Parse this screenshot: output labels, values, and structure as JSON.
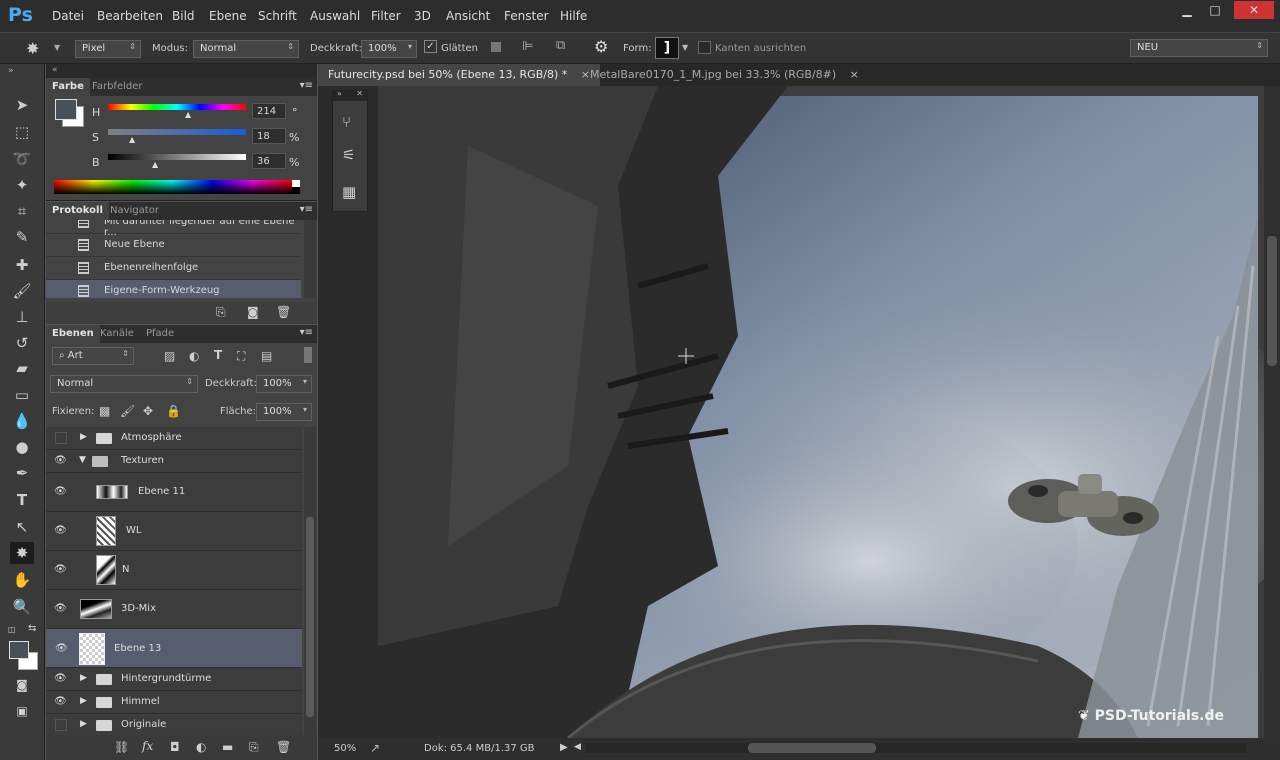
{
  "menubar": {
    "logo": "Ps",
    "items": [
      "Datei",
      "Bearbeiten",
      "Bild",
      "Ebene",
      "Schrift",
      "Auswahl",
      "Filter",
      "3D",
      "Ansicht",
      "Fenster",
      "Hilfe"
    ],
    "minimize": "▁",
    "maximize": "□",
    "close": "✕"
  },
  "options": {
    "mode_select": "Pixel",
    "modus_label": "Modus:",
    "modus_value": "Normal",
    "opacity_label": "Deckkraft:",
    "opacity_value": "100%",
    "smooth_label": "Glätten",
    "form_label": "Form:",
    "align_label": "Kanten ausrichten",
    "workspace": "NEU"
  },
  "color_panel": {
    "tabs": [
      "Farbe",
      "Farbfelder"
    ],
    "h_label": "H",
    "h_value": "214",
    "h_unit": "°",
    "s_label": "S",
    "s_value": "18",
    "s_unit": "%",
    "b_label": "B",
    "b_value": "36",
    "b_unit": "%"
  },
  "history_panel": {
    "tabs": [
      "Protokoll",
      "Navigator"
    ],
    "items": [
      "Mit darunter liegender auf eine Ebene r...",
      "Neue Ebene",
      "Ebenenreihenfolge",
      "Eigene-Form-Werkzeug"
    ]
  },
  "layers_panel": {
    "tabs": [
      "Ebenen",
      "Kanäle",
      "Pfade"
    ],
    "filter_label": "Art",
    "blend_mode": "Normal",
    "opacity_label": "Deckkraft:",
    "opacity_value": "100%",
    "lock_label": "Fixieren:",
    "fill_label": "Fläche:",
    "fill_value": "100%",
    "layers": [
      {
        "name": "Atmosphäre",
        "type": "folder",
        "visible": false
      },
      {
        "name": "Texturen",
        "type": "folder-open",
        "visible": true
      },
      {
        "name": "Ebene 11",
        "type": "layer",
        "visible": true
      },
      {
        "name": "WL",
        "type": "layer",
        "visible": true
      },
      {
        "name": "N",
        "type": "layer",
        "visible": true
      },
      {
        "name": "3D-Mix",
        "type": "layer",
        "visible": true
      },
      {
        "name": "Ebene 13",
        "type": "layer",
        "visible": true,
        "selected": true
      },
      {
        "name": "Hintergrundtürme",
        "type": "folder",
        "visible": true
      },
      {
        "name": "Himmel",
        "type": "folder",
        "visible": true
      },
      {
        "name": "Originale",
        "type": "folder",
        "visible": false
      }
    ]
  },
  "documents": {
    "tabs": [
      {
        "title": "Futurecity.psd bei 50% (Ebene 13, RGB/8) *",
        "active": true
      },
      {
        "title": "MetalBare0170_1_M.jpg bei 33.3% (RGB/8#)",
        "active": false
      }
    ],
    "close_glyph": "×"
  },
  "status": {
    "zoom": "50%",
    "doc_info": "Dok: 65.4 MB/1.37 GB"
  },
  "watermark": "PSD-Tutorials.de",
  "colors": {
    "accent": "#4ea8f0",
    "selected_layer": "#575c6e",
    "sky": "#7f8fa6"
  }
}
